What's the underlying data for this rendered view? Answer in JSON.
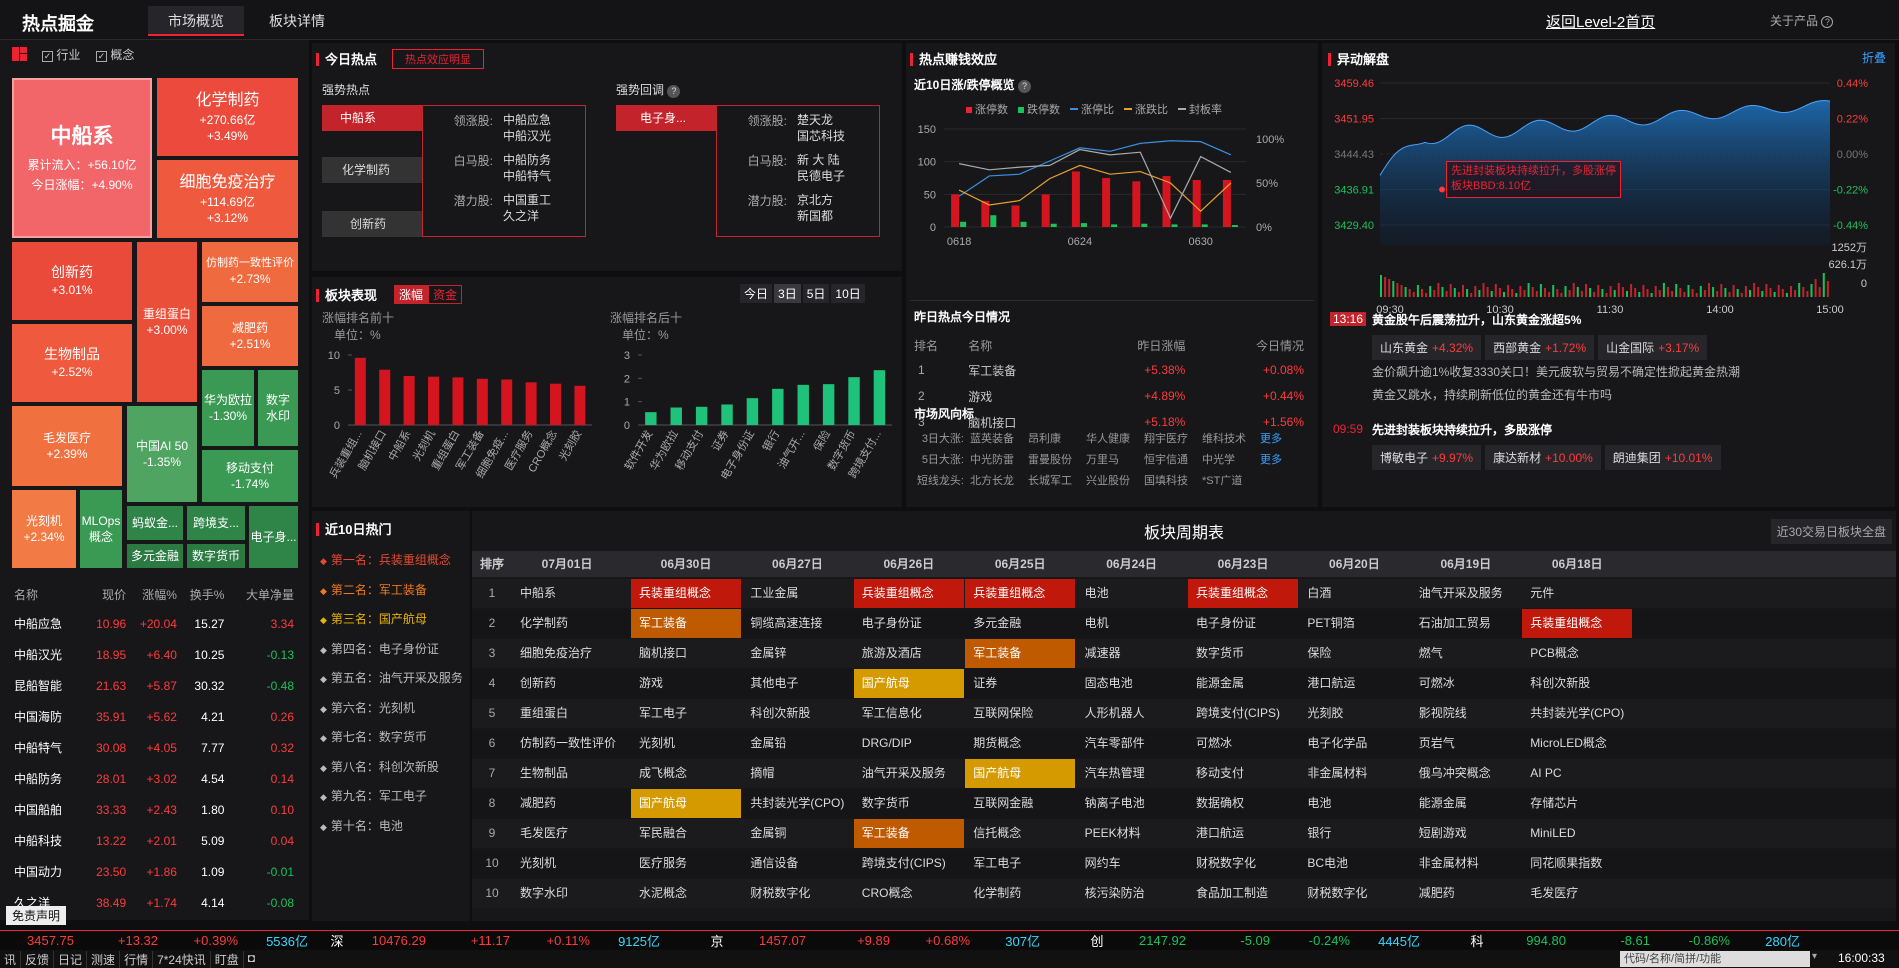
{
  "app": {
    "title": "热点掘金",
    "tabs": [
      "市场概览",
      "板块详情"
    ],
    "return_link": "返回Level-2首页",
    "about": "关于产品"
  },
  "left": {
    "filters": [
      "行业",
      "概念"
    ],
    "treemap": [
      {
        "name": "中船系",
        "l1": "累计流入：+56.10亿",
        "l2": "今日涨幅：+4.90%"
      },
      {
        "name": "化学制药",
        "l1": "+270.66亿",
        "l2": "+3.49%"
      },
      {
        "name": "细胞免疫治疗",
        "l1": "+114.69亿",
        "l2": "+3.12%"
      },
      {
        "name": "创新药",
        "l1": "+3.01%"
      },
      {
        "name": "重组蛋白",
        "l1": "+3.00%"
      },
      {
        "name": "仿制药一致性评价",
        "l1": "+2.73%"
      },
      {
        "name": "减肥药",
        "l1": "+2.51%"
      },
      {
        "name": "生物制品",
        "l1": "+2.52%"
      },
      {
        "name": "华为欧拉",
        "l1": "-1.30%"
      },
      {
        "name": "数字水印",
        "l1": ""
      },
      {
        "name": "中国AI 50",
        "l1": "-1.35%"
      },
      {
        "name": "毛发医疗",
        "l1": "+2.39%"
      },
      {
        "name": "移动支付",
        "l1": "-1.74%"
      },
      {
        "name": "光刻机",
        "l1": "+2.34%"
      },
      {
        "name": "MLOps概念",
        "l1": ""
      },
      {
        "name": "蚂蚁金...",
        "l1": ""
      },
      {
        "name": "跨境支...",
        "l1": ""
      },
      {
        "name": "电子身...",
        "l1": ""
      },
      {
        "name": "多元金融",
        "l1": ""
      },
      {
        "name": "数字货币",
        "l1": ""
      }
    ],
    "table_headers": [
      "名称",
      "现价",
      "涨幅%",
      "换手%",
      "大单净量"
    ],
    "stocks": [
      [
        "中船应急",
        "10.96",
        "+20.04",
        "15.27",
        "3.34"
      ],
      [
        "中船汉光",
        "18.95",
        "+6.40",
        "10.25",
        "-0.13"
      ],
      [
        "昆船智能",
        "21.63",
        "+5.87",
        "30.32",
        "-0.48"
      ],
      [
        "中国海防",
        "35.91",
        "+5.62",
        "4.21",
        "0.26"
      ],
      [
        "中船特气",
        "30.08",
        "+4.05",
        "7.77",
        "0.32"
      ],
      [
        "中船防务",
        "28.01",
        "+3.02",
        "4.54",
        "0.14"
      ],
      [
        "中国船舶",
        "33.33",
        "+2.43",
        "1.80",
        "0.10"
      ],
      [
        "中船科技",
        "13.22",
        "+2.01",
        "5.09",
        "0.04"
      ],
      [
        "中国动力",
        "23.50",
        "+1.86",
        "1.09",
        "-0.01"
      ],
      [
        "久之洋",
        "38.49",
        "+1.74",
        "4.14",
        "-0.08"
      ]
    ],
    "disclaimer": "免责声明"
  },
  "today_hot": {
    "title": "今日热点",
    "tag": "热点效应明显",
    "strong_label": "强势热点",
    "pullback_label": "强势回调",
    "strong_items": [
      "中船系",
      "化学制药",
      "创新药"
    ],
    "strong_detail": [
      {
        "k": "领涨股:",
        "v": [
          "中船应急",
          "中船汉光"
        ]
      },
      {
        "k": "白马股:",
        "v": [
          "中船防务",
          "中船特气"
        ]
      },
      {
        "k": "潜力股:",
        "v": [
          "中国重工",
          "久之洋"
        ]
      }
    ],
    "pullback_items": [
      "电子身..."
    ],
    "pullback_detail": [
      {
        "k": "领涨股:",
        "v": [
          "楚天龙",
          "国芯科技"
        ]
      },
      {
        "k": "白马股:",
        "v": [
          "新 大 陆",
          "民德电子"
        ]
      },
      {
        "k": "潜力股:",
        "v": [
          "京北方",
          "新国都"
        ]
      }
    ]
  },
  "sector_perf": {
    "title": "板块表现",
    "toggle": [
      "涨幅",
      "资金"
    ],
    "periods": [
      "今日",
      "3日",
      "5日",
      "10日"
    ],
    "top_label": "涨幅排名前十",
    "bottom_label": "涨幅排名后十",
    "unit": "单位：%"
  },
  "chart_data": [
    {
      "type": "bar",
      "title": "涨幅排名前十",
      "ylabel": "单位：%",
      "ylim": [
        0,
        10
      ],
      "categories": [
        "兵装重组...",
        "脑机接口",
        "中船系",
        "光刻机",
        "重组蛋白",
        "军工装备",
        "细胞免疫...",
        "医疗服务",
        "CRO概念",
        "光刻胶"
      ],
      "values": [
        9.6,
        7.9,
        7.0,
        6.9,
        6.8,
        6.6,
        6.5,
        6.1,
        5.9,
        5.6
      ],
      "color": "#d4141e"
    },
    {
      "type": "bar",
      "title": "涨幅排名后十",
      "ylabel": "单位：%",
      "ylim": [
        0,
        3
      ],
      "categories": [
        "软件开发",
        "华为欧拉",
        "移动支付",
        "证券",
        "电子身份证",
        "银行",
        "油气开...",
        "保险",
        "数字货币",
        "跨境支付..."
      ],
      "values": [
        0.55,
        0.75,
        0.78,
        0.88,
        1.15,
        1.55,
        1.72,
        1.75,
        2.05,
        2.35
      ],
      "color": "#1fc27a"
    },
    {
      "type": "bar",
      "title": "近10日涨/跌停概览",
      "x": [
        "0618",
        "0619",
        "0620",
        "0623",
        "0624",
        "0625",
        "0626",
        "0627",
        "0630",
        "0701"
      ],
      "series": [
        {
          "name": "涨停数",
          "values": [
            50,
            40,
            33,
            50,
            85,
            75,
            70,
            78,
            72,
            72
          ]
        },
        {
          "name": "跌停数",
          "values": [
            8,
            18,
            8,
            5,
            6,
            4,
            5,
            4,
            4,
            3
          ]
        },
        {
          "name": "涨停比",
          "values": [
            35,
            58,
            60,
            75,
            90,
            86,
            95,
            98,
            97,
            82
          ]
        },
        {
          "name": "涨跌比",
          "values": [
            42,
            25,
            30,
            55,
            70,
            60,
            63,
            50,
            18,
            50
          ]
        },
        {
          "name": "封板率",
          "values": [
            72,
            65,
            68,
            70,
            88,
            82,
            85,
            10,
            80,
            62
          ]
        }
      ],
      "ylim": [
        0,
        150
      ],
      "ylim_right": [
        0,
        100
      ]
    }
  ],
  "money_effect": {
    "title": "热点赚钱效应",
    "subtitle": "近10日涨/跌停概览",
    "legend": [
      "涨停数",
      "跌停数",
      "涨停比",
      "涨跌比",
      "封板率"
    ],
    "yticks": [
      "150",
      "100",
      "50",
      "0"
    ],
    "ryticks": [
      "100%",
      "50%",
      "0%"
    ],
    "xticks": [
      "0618",
      "0624",
      "0630"
    ]
  },
  "yesterday": {
    "title": "昨日热点今日情况",
    "headers": [
      "排名",
      "名称",
      "昨日涨幅",
      "今日情况"
    ],
    "rows": [
      [
        "1",
        "军工装备",
        "+5.38%",
        "+0.08%"
      ],
      [
        "2",
        "游戏",
        "+4.89%",
        "+0.44%"
      ],
      [
        "3",
        "脑机接口",
        "+5.18%",
        "+1.56%"
      ]
    ]
  },
  "market_wind": {
    "title": "市场风向标",
    "rows": [
      {
        "k": "3日大涨:",
        "v": [
          "蓝英装备",
          "昂利康",
          "华人健康",
          "翔宇医疗",
          "维科技术"
        ],
        "more": "更多"
      },
      {
        "k": "5日大涨:",
        "v": [
          "中光防雷",
          "雷曼股份",
          "万里马",
          "恒宇信通",
          "中光学"
        ],
        "more": "更多"
      },
      {
        "k": "短线龙头:",
        "v": [
          "北方长龙",
          "长城军工",
          "兴业股份",
          "国填科技",
          "*ST广道"
        ],
        "more": ""
      }
    ]
  },
  "anomaly": {
    "title": "异动解盘",
    "collapse": "折叠",
    "prices": [
      "3459.46",
      "3451.95",
      "3444.43",
      "3436.91",
      "3429.40"
    ],
    "pcts": [
      "0.44%",
      "0.22%",
      "0.00%",
      "-0.22%",
      "-0.44%"
    ],
    "vols": [
      "1252万",
      "626.1万",
      "0"
    ],
    "times": [
      "09:30",
      "10:30",
      "11:30",
      "14:00",
      "15:00"
    ],
    "tooltip": [
      "先进封装板块持续拉升，多股涨停",
      "板块BBD:8.10亿"
    ],
    "events": [
      {
        "time": "13:16",
        "title": "黄金股午后震荡拉升，山东黄金涨超5%",
        "stocks": [
          [
            "山东黄金",
            "+4.32%"
          ],
          [
            "西部黄金",
            "+1.72%"
          ],
          [
            "山金国际",
            "+3.17%"
          ]
        ],
        "news": [
          "金价飙升逾1%收复3330关口！美元疲软与贸易不确定性掀起黄金热潮",
          "黄金又跳水，持续刷新低位的黄金还有牛市吗"
        ]
      },
      {
        "time": "09:59",
        "title": "先进封装板块持续拉升，多股涨停",
        "stocks": [
          [
            "博敏电子",
            "+9.97%"
          ],
          [
            "康达新材",
            "+10.00%"
          ],
          [
            "朗迪集团",
            "+10.01%"
          ]
        ],
        "news": []
      }
    ]
  },
  "recent_hot": {
    "title": "近10日热门",
    "ranks": [
      "第一名：兵装重组概念",
      "第二名：军工装备",
      "第三名：国产航母",
      "第四名：电子身份证",
      "第五名：油气开采及服务",
      "第六名：光刻机",
      "第七名：数字货币",
      "第八名：科创次新股",
      "第九名：军工电子",
      "第十名：电池"
    ]
  },
  "cycle": {
    "title": "板块周期表",
    "btn": "近30交易日板块全盘",
    "headers": [
      "排序",
      "07月01日",
      "06月30日",
      "06月27日",
      "06月26日",
      "06月25日",
      "06月24日",
      "06月23日",
      "06月20日",
      "06月19日",
      "06月18日"
    ],
    "rows": [
      [
        "1",
        "中船系",
        "兵装重组概念",
        "工业金属",
        "兵装重组概念",
        "兵装重组概念",
        "电池",
        "兵装重组概念",
        "白酒",
        "油气开采及服务",
        "元件"
      ],
      [
        "2",
        "化学制药",
        "军工装备",
        "铜缆高速连接",
        "电子身份证",
        "多元金融",
        "电机",
        "电子身份证",
        "PET铜箔",
        "石油加工贸易",
        "兵装重组概念"
      ],
      [
        "3",
        "细胞免疫治疗",
        "脑机接口",
        "金属锌",
        "旅游及酒店",
        "军工装备",
        "减速器",
        "数字货币",
        "保险",
        "燃气",
        "PCB概念"
      ],
      [
        "4",
        "创新药",
        "游戏",
        "其他电子",
        "国产航母",
        "证券",
        "固态电池",
        "能源金属",
        "港口航运",
        "可燃冰",
        "科创次新股"
      ],
      [
        "5",
        "重组蛋白",
        "军工电子",
        "科创次新股",
        "军工信息化",
        "互联网保险",
        "人形机器人",
        "跨境支付(CIPS)",
        "光刻胶",
        "影视院线",
        "共封装光学(CPO)"
      ],
      [
        "6",
        "仿制药一致性评价",
        "光刻机",
        "金属铅",
        "DRG/DIP",
        "期货概念",
        "汽车零部件",
        "可燃冰",
        "电子化学品",
        "页岩气",
        "MicroLED概念"
      ],
      [
        "7",
        "生物制品",
        "成飞概念",
        "摘帽",
        "油气开采及服务",
        "国产航母",
        "汽车热管理",
        "移动支付",
        "非金属材料",
        "俄乌冲突概念",
        "AI PC"
      ],
      [
        "8",
        "减肥药",
        "国产航母",
        "共封装光学(CPO)",
        "数字货币",
        "互联网金融",
        "钠离子电池",
        "数据确权",
        "电池",
        "能源金属",
        "存储芯片"
      ],
      [
        "9",
        "毛发医疗",
        "军民融合",
        "金属铜",
        "军工装备",
        "信托概念",
        "PEEK材料",
        "港口航运",
        "银行",
        "短剧游戏",
        "MiniLED"
      ],
      [
        "10",
        "光刻机",
        "医疗服务",
        "通信设备",
        "跨境支付(CIPS)",
        "军工电子",
        "网约车",
        "财税数字化",
        "BC电池",
        "非金属材料",
        "同花顺果指数"
      ],
      [
        "10",
        "数字水印",
        "水泥概念",
        "财税数字化",
        "CRO概念",
        "化学制药",
        "核污染防治",
        "食品加工制造",
        "财税数字化",
        "减肥药",
        "毛发医疗"
      ]
    ],
    "highlights": {
      "兵装重组概念": "red",
      "军工装备": "or",
      "国产航母": "ye"
    }
  },
  "ticker": [
    {
      "label": "",
      "price": "3457.75",
      "chg": "+13.32",
      "pct": "+0.39%",
      "amt": "5536亿"
    },
    {
      "label": "深",
      "price": "10476.29",
      "chg": "+11.17",
      "pct": "+0.11%",
      "amt": "9125亿"
    },
    {
      "label": "京",
      "price": "1457.07",
      "chg": "+9.89",
      "pct": "+0.68%",
      "amt": "307亿"
    },
    {
      "label": "创",
      "price": "2147.92",
      "chg": "-5.09",
      "pct": "-0.24%",
      "amt": "4445亿"
    },
    {
      "label": "科",
      "price": "994.80",
      "chg": "-8.61",
      "pct": "-0.86%",
      "amt": "280亿"
    }
  ],
  "bottom": {
    "items": [
      "讯",
      "反馈",
      "日记",
      "测速",
      "行情",
      "7*24快讯",
      "盯盘"
    ],
    "search_placeholder": "代码/名称/简拼/功能",
    "clock": "16:00:33"
  }
}
